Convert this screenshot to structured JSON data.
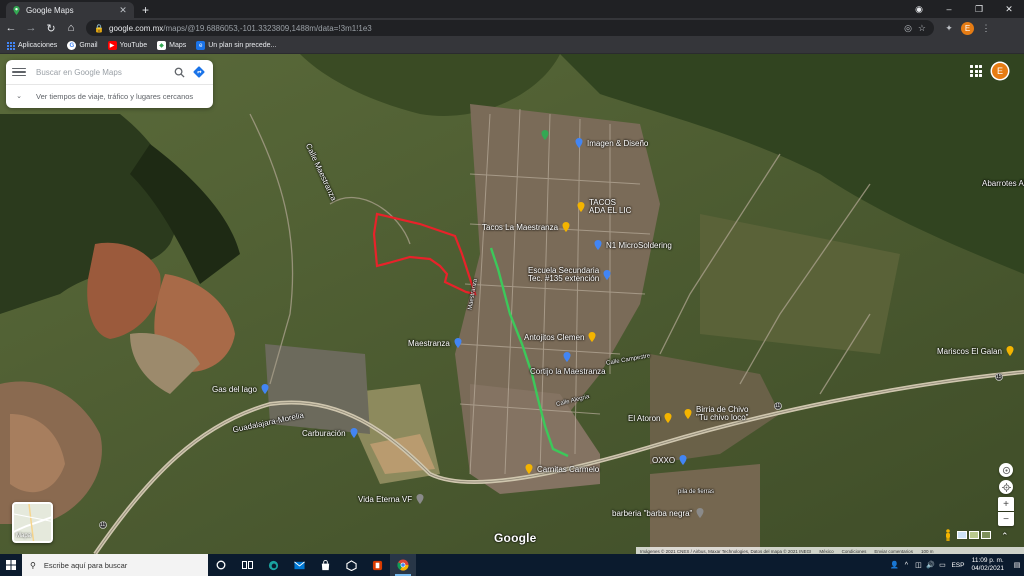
{
  "browser": {
    "tab_title": "Google Maps",
    "new_tab_label": "+",
    "url_host": "google.com.mx",
    "url_rest": "/maps/@19.6886053,-101.3323809,1488m/data=!3m1!1e3",
    "avatar_initial": "E",
    "window_controls": {
      "minimize": "–",
      "maximize": "❐",
      "close": "✕"
    },
    "bookmarks": [
      {
        "label": "Aplicaciones",
        "icon": "apps-grid-icon"
      },
      {
        "label": "Gmail",
        "icon": "google-g-icon"
      },
      {
        "label": "YouTube",
        "icon": "youtube-icon"
      },
      {
        "label": "Maps",
        "icon": "maps-icon"
      },
      {
        "label": "Un plan sin precede...",
        "icon": "bookmark-page-icon"
      }
    ]
  },
  "maps": {
    "search_placeholder": "Buscar en Google Maps",
    "travel_link": "Ver tiempos de viaje, tráfico y lugares cercanos",
    "avatar_initial": "E",
    "layers_label": "Mapa",
    "logo": "Google",
    "attribution": {
      "images": "Imágenes © 2021 CNES / Airbus, Maxar Technologies, Datos del mapa © 2021 INEGI",
      "country": "México",
      "terms": "Condiciones",
      "feedback": "Enviar comentarios",
      "scale": "100 m"
    },
    "labels": {
      "abarrotes": "Abarrotes Al",
      "mariscos": "Mariscos El Galan",
      "imagen": "Imagen & Diseño",
      "tacos1_line1": "TACOS",
      "tacos1_line2": "ADA EL LIC",
      "tacos2": "Tacos La Maestranza",
      "microsoldering": "N1 MicroSoldering",
      "escuela_line1": "Escuela Secundaria",
      "escuela_line2": "Tec. #135 extención",
      "maestranza": "Maestranza",
      "antojitos": "Antojitos Clemen",
      "cortijo": "Cortijo la Maestranza",
      "gas": "Gas del lago",
      "carburacion": "Carburación",
      "guadalajara": "Guadalajara-Morelia",
      "el_atoron": "El Atoron",
      "birria_line1": "Birria de Chivo",
      "birria_line2": "\"Tu chivo loco\"",
      "oxxo": "OXXO",
      "carnitas": "Carnitas Carmelo",
      "vida_eterna": "Vida Eterna VF",
      "barberia": "barberia \"barba negra\"",
      "pila": "pila de fierras",
      "maestranza_road": "Maestranza",
      "road_label": "Calle Maestranza",
      "road_label2": "Calle Campestre",
      "road_label3": "Calle Alegría",
      "road_highway": "15",
      "road_11": "11",
      "road_11b": "11",
      "road_15b": "15"
    }
  },
  "taskbar": {
    "search_placeholder": "Escribe aquí para buscar",
    "language": "ESP",
    "time": "11:09 p. m.",
    "date": "04/02/2021"
  },
  "colors": {
    "boundary_red": "#e8222a",
    "route_green": "#3cc85a",
    "pin_yellow": "#f4b400",
    "pin_blue": "#4285f4"
  }
}
